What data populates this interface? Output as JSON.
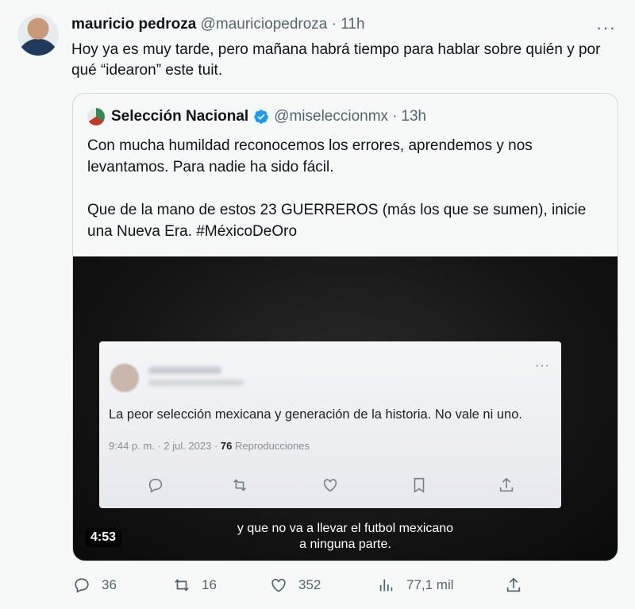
{
  "tweet": {
    "author_name": "mauricio pedroza",
    "handle": "@mauriciopedroza",
    "separator": "·",
    "time": "11h",
    "text": "Hoy ya es muy tarde, pero mañana habrá tiempo para hablar sobre quién y por qué “idearon” este tuit."
  },
  "quote": {
    "author_name": "Selección Nacional",
    "handle": "@miseleccionmx",
    "separator": "·",
    "time": "13h",
    "text": "Con mucha humildad reconocemos los errores, aprendemos y nos levantamos. Para nadie ha sido fácil.\n\nQue de la mano de estos 23 GUERREROS (más los que se sumen), inicie una Nueva Era. #MéxicoDeOro"
  },
  "media": {
    "embedded_tweet_text": "La peor selección mexicana y generación de la historia. No vale ni uno.",
    "embedded_tweet_meta": "9:44 p. m. · 2 jul. 2023 · ",
    "embedded_views_count": "76",
    "embedded_views_label": "Reproducciones",
    "duration": "4:53",
    "subtitle": "y que no va a llevar el futbol mexicano\na ninguna parte."
  },
  "actions": {
    "replies": "36",
    "retweets": "16",
    "likes": "352",
    "views": "77,1 mil"
  }
}
